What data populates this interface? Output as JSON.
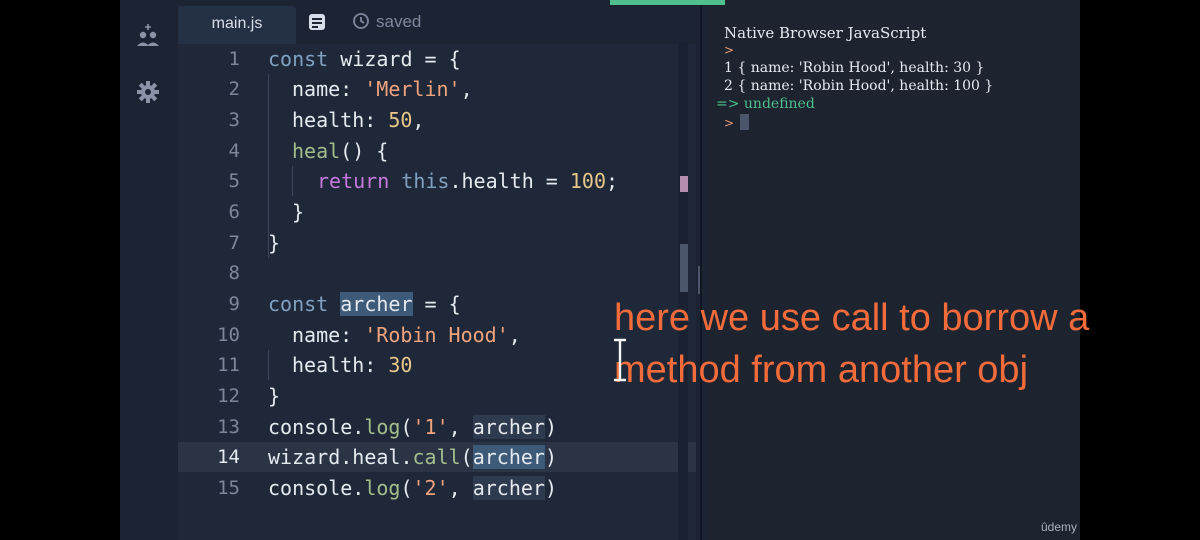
{
  "editor": {
    "tab_label": "main.js",
    "status": "saved",
    "current_line": 14
  },
  "code_lines": [
    {
      "n": "1"
    },
    {
      "n": "2"
    },
    {
      "n": "3"
    },
    {
      "n": "4"
    },
    {
      "n": "5"
    },
    {
      "n": "6"
    },
    {
      "n": "7"
    },
    {
      "n": "8"
    },
    {
      "n": "9"
    },
    {
      "n": "10"
    },
    {
      "n": "11"
    },
    {
      "n": "12"
    },
    {
      "n": "13"
    },
    {
      "n": "14"
    },
    {
      "n": "15"
    }
  ],
  "code": {
    "l1": [
      "const",
      "wizard = {"
    ],
    "l2": [
      "name: ",
      "'Merlin'",
      ","
    ],
    "l3": [
      "health: ",
      "50",
      ","
    ],
    "l4": [
      "heal",
      "() {"
    ],
    "l5": [
      "return",
      "this",
      ".health = ",
      "100",
      ";"
    ],
    "l6": [
      "}"
    ],
    "l7": [
      "}"
    ],
    "l9": [
      "const",
      "archer",
      " = {"
    ],
    "l10": [
      "name: ",
      "'Robin Hood'",
      ","
    ],
    "l11": [
      "health: ",
      "30"
    ],
    "l12": [
      "}"
    ],
    "l13": [
      "console.",
      "log",
      "(",
      "'1'",
      ", ",
      "archer",
      ")"
    ],
    "l14": [
      "wizard.heal.",
      "call",
      "(",
      "archer",
      ")"
    ],
    "l15": [
      "console.",
      "log",
      "(",
      "'2'",
      ", ",
      "archer",
      ")"
    ]
  },
  "console": {
    "title": "Native Browser JavaScript",
    "prompt_glyph": ">",
    "output_1": "1 { name: 'Robin Hood', health: 30 }",
    "output_2": "2 { name: 'Robin Hood', health: 100 }",
    "return_text": "=> undefined"
  },
  "annotation": {
    "line1": "here we use call to borrow a",
    "line2": "method from another obj"
  },
  "watermark": "ûdemy",
  "colors": {
    "accent": "#4fc08d",
    "annotation": "#f26b3a",
    "keyword": "#81a1c1",
    "string": "#f0a37c",
    "number": "#e8c88a"
  },
  "icons": [
    "add-users-icon",
    "gear-icon",
    "document-icon",
    "history-icon"
  ]
}
